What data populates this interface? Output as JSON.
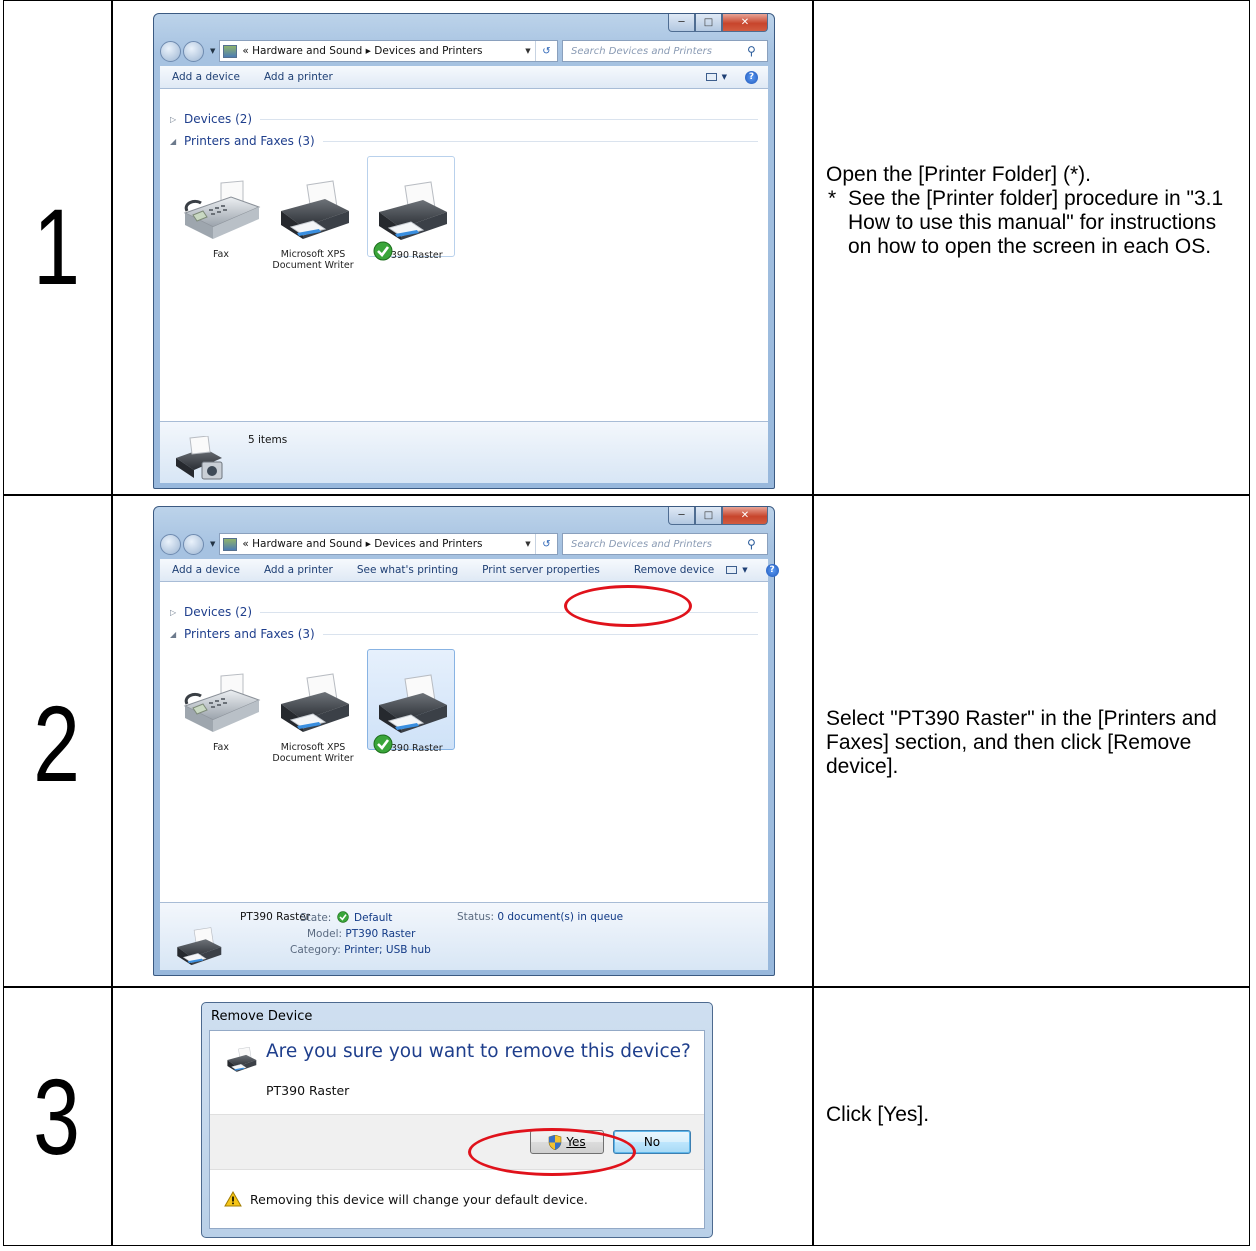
{
  "steps": [
    {
      "number": "1",
      "window": {
        "titlebar_buttons": [
          "minimize",
          "maximize",
          "close"
        ],
        "breadcrumb": "«  Hardware and Sound  ▸  Devices and Printers",
        "search_placeholder": "Search Devices and Printers",
        "commands": [
          "Add a device",
          "Add a printer"
        ],
        "groups": [
          {
            "label": "Devices (2)",
            "expanded": false
          },
          {
            "label": "Printers and Faxes (3)",
            "expanded": true
          }
        ],
        "devices": [
          {
            "name": "Fax",
            "selected": false
          },
          {
            "name": "Microsoft XPS Document Writer",
            "selected": false
          },
          {
            "name": "PT390 Raster",
            "selected": true,
            "default": true
          }
        ],
        "status": "5 items"
      },
      "description": "Open the [Printer Folder] (*).",
      "note_mark": "*",
      "note": "See the [Printer folder] procedure in \"3.1 How to use this manual\" for instructions on how to open the screen in each OS."
    },
    {
      "number": "2",
      "window": {
        "breadcrumb": "«  Hardware and Sound  ▸  Devices and Printers",
        "search_placeholder": "Search Devices and Printers",
        "commands": [
          "Add a device",
          "Add a printer",
          "See what's printing",
          "Print server properties",
          "Remove device"
        ],
        "highlighted_command": "Remove device",
        "groups": [
          {
            "label": "Devices (2)",
            "expanded": false
          },
          {
            "label": "Printers and Faxes (3)",
            "expanded": true
          }
        ],
        "devices": [
          {
            "name": "Fax",
            "selected": false
          },
          {
            "name": "Microsoft XPS Document Writer",
            "selected": false
          },
          {
            "name": "PT390 Raster",
            "selected": true,
            "default": true
          }
        ],
        "details": {
          "name": "PT390 Raster",
          "state_label": "State:",
          "state_value": "Default",
          "model_label": "Model:",
          "model_value": "PT390 Raster",
          "category_label": "Category:",
          "category_value": "Printer; USB hub",
          "status_label": "Status:",
          "status_value": "0 document(s) in queue"
        }
      },
      "description": "Select \"PT390 Raster\" in the [Printers and Faxes] section, and then click [Remove device]."
    },
    {
      "number": "3",
      "dialog": {
        "title": "Remove Device",
        "question": "Are you sure you want to remove this device?",
        "device": "PT390 Raster",
        "yes_label": "Yes",
        "no_label": "No",
        "highlighted_button": "Yes",
        "warning": "Removing this device will change your default device."
      },
      "description": "Click [Yes]."
    }
  ],
  "colors": {
    "highlight_oval": "#e0121b",
    "link_text": "#1e3e8c",
    "selection": "#cfe2f8"
  }
}
